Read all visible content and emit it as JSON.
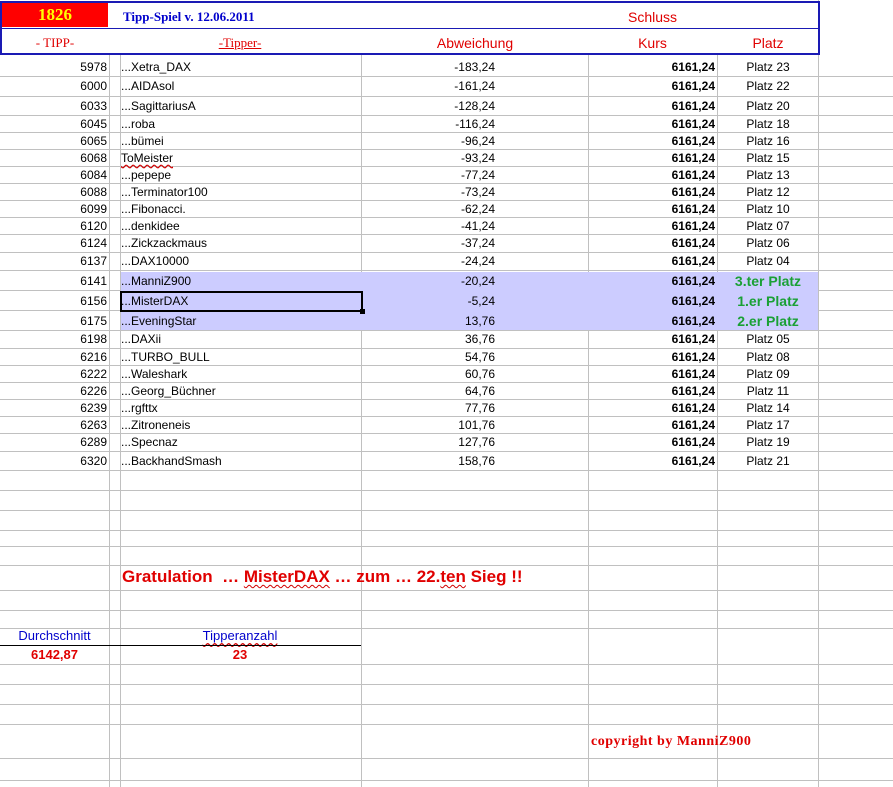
{
  "header": {
    "year": "1826",
    "sheet_title": "Tipp-Spiel v. 12.06.2011",
    "schluss": "Schluss",
    "col_tipp": "- TIPP-",
    "col_tipper": "-Tipper-",
    "col_abweichung": "Abweichung",
    "col_kurs": "Kurs",
    "col_platz": "Platz"
  },
  "rows": [
    {
      "tipp": "5978",
      "name": "...Xetra_DAX",
      "dev": "-183,24",
      "kurs": "6161,24",
      "platz": "Platz 23"
    },
    {
      "tipp": "6000",
      "name": "...AIDAsol",
      "dev": "-161,24",
      "kurs": "6161,24",
      "platz": "Platz 22"
    },
    {
      "tipp": "6033",
      "name": "...SagittariusA",
      "dev": "-128,24",
      "kurs": "6161,24",
      "platz": "Platz 20"
    },
    {
      "tipp": "6045",
      "name": "...roba",
      "dev": "-116,24",
      "kurs": "6161,24",
      "platz": "Platz 18"
    },
    {
      "tipp": "6065",
      "name": "...bümei",
      "dev": "-96,24",
      "kurs": "6161,24",
      "platz": "Platz 16"
    },
    {
      "tipp": "6068",
      "name": "ToMeister",
      "dev": "-93,24",
      "kurs": "6161,24",
      "platz": "Platz 15"
    },
    {
      "tipp": "6084",
      "name": "...pepepe",
      "dev": "-77,24",
      "kurs": "6161,24",
      "platz": "Platz 13"
    },
    {
      "tipp": "6088",
      "name": "...Terminator100",
      "dev": "-73,24",
      "kurs": "6161,24",
      "platz": "Platz 12"
    },
    {
      "tipp": "6099",
      "name": "...Fibonacci.",
      "dev": "-62,24",
      "kurs": "6161,24",
      "platz": "Platz 10"
    },
    {
      "tipp": "6120",
      "name": "...denkidee",
      "dev": "-41,24",
      "kurs": "6161,24",
      "platz": "Platz 07"
    },
    {
      "tipp": "6124",
      "name": "...Zickzackmaus",
      "dev": "-37,24",
      "kurs": "6161,24",
      "platz": "Platz 06"
    },
    {
      "tipp": "6137",
      "name": "...DAX10000",
      "dev": "-24,24",
      "kurs": "6161,24",
      "platz": "Platz 04"
    },
    {
      "tipp": "6141",
      "name": "...ManniZ900",
      "dev": "-20,24",
      "kurs": "6161,24",
      "platz": "3.ter Platz"
    },
    {
      "tipp": "6156",
      "name": "...MisterDAX",
      "dev": "-5,24",
      "kurs": "6161,24",
      "platz": "1.er Platz"
    },
    {
      "tipp": "6175",
      "name": "...EveningStar",
      "dev": "13,76",
      "kurs": "6161,24",
      "platz": "2.er Platz"
    },
    {
      "tipp": "6198",
      "name": "...DAXii",
      "dev": "36,76",
      "kurs": "6161,24",
      "platz": "Platz 05"
    },
    {
      "tipp": "6216",
      "name": "...TURBO_BULL",
      "dev": "54,76",
      "kurs": "6161,24",
      "platz": "Platz 08"
    },
    {
      "tipp": "6222",
      "name": "...Waleshark",
      "dev": "60,76",
      "kurs": "6161,24",
      "platz": "Platz 09"
    },
    {
      "tipp": "6226",
      "name": "...Georg_Büchner",
      "dev": "64,76",
      "kurs": "6161,24",
      "platz": "Platz 11"
    },
    {
      "tipp": "6239",
      "name": "...rgfttx",
      "dev": "77,76",
      "kurs": "6161,24",
      "platz": "Platz 14"
    },
    {
      "tipp": "6263",
      "name": "...Zitroneneis",
      "dev": "101,76",
      "kurs": "6161,24",
      "platz": "Platz 17"
    },
    {
      "tipp": "6289",
      "name": "...Specnaz",
      "dev": "127,76",
      "kurs": "6161,24",
      "platz": "Platz 19"
    },
    {
      "tipp": "6320",
      "name": "...BackhandSmash",
      "dev": "158,76",
      "kurs": "6161,24",
      "platz": "Platz 21"
    }
  ],
  "winners": [
    "...ManniZ900",
    "...MisterDAX",
    "...EveningStar"
  ],
  "congrats": {
    "prefix": "Gratulation  … ",
    "winner": "MisterDAX",
    "middle": " … zum … 22.",
    "ten": "ten",
    "suffix": " Sieg !!"
  },
  "summary": {
    "avg_label": "Durchschnitt",
    "avg_value": "6142,87",
    "count_label": "Tipperanzahl",
    "count_value": "23"
  },
  "copyright": "copyright by ManniZ900",
  "colors": {
    "header_border": "#1a1ab4",
    "year_bg": "#ff0000",
    "year_text": "#ffff00",
    "title_blue": "#0000cc",
    "header_red": "#e00000",
    "highlight": "#ccccff",
    "winner_green": "#1aa035"
  }
}
